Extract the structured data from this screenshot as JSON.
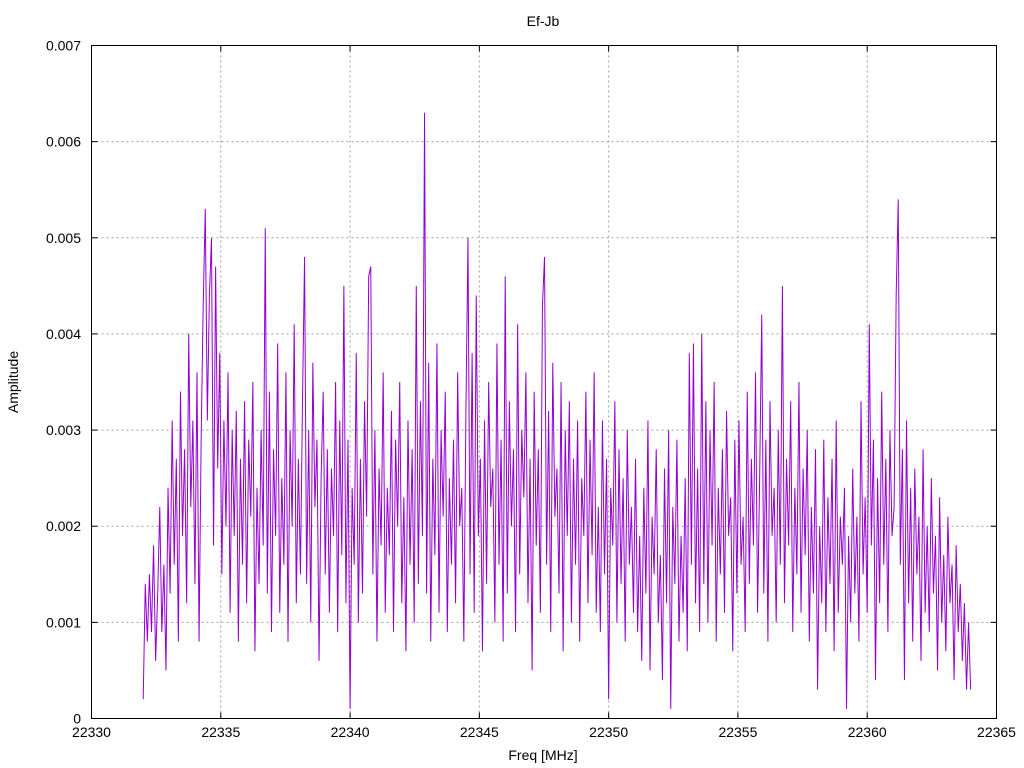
{
  "chart_data": {
    "type": "line",
    "title": "Ef-Jb",
    "xlabel": "Freq [MHz]",
    "ylabel": "Amplitude",
    "xlim": [
      22330,
      22365
    ],
    "ylim": [
      0,
      0.007
    ],
    "xticks": [
      22330,
      22335,
      22340,
      22345,
      22350,
      22355,
      22360,
      22365
    ],
    "xtick_labels": [
      "22330",
      "22335",
      "22340",
      "22345",
      "22350",
      "22355",
      "22360",
      "22365"
    ],
    "yticks": [
      0,
      0.001,
      0.002,
      0.003,
      0.004,
      0.005,
      0.006,
      0.007
    ],
    "ytick_labels": [
      "0",
      "0.001",
      "0.002",
      "0.003",
      "0.004",
      "0.005",
      "0.006",
      "0.007"
    ],
    "grid": true,
    "legend": "none",
    "series": [
      {
        "name": "Ef-Jb",
        "color": "#9400d3",
        "x_start": 22332.0,
        "x_step": 0.08,
        "values": [
          0.0002,
          0.0014,
          0.0008,
          0.0015,
          0.0009,
          0.0018,
          0.0006,
          0.0013,
          0.0022,
          0.0009,
          0.0016,
          0.0005,
          0.0024,
          0.0013,
          0.0031,
          0.0016,
          0.0027,
          0.0008,
          0.0034,
          0.0019,
          0.0028,
          0.0012,
          0.004,
          0.0022,
          0.0031,
          0.0014,
          0.0036,
          0.0008,
          0.0029,
          0.0043,
          0.0053,
          0.0031,
          0.0044,
          0.005,
          0.0018,
          0.0047,
          0.0026,
          0.0038,
          0.0015,
          0.0031,
          0.002,
          0.0036,
          0.0011,
          0.003,
          0.0019,
          0.0032,
          0.0008,
          0.0027,
          0.0016,
          0.0033,
          0.0012,
          0.0029,
          0.0021,
          0.0035,
          0.0007,
          0.0024,
          0.0014,
          0.003,
          0.0018,
          0.0051,
          0.0013,
          0.0034,
          0.0009,
          0.0028,
          0.0019,
          0.0039,
          0.0011,
          0.0025,
          0.0016,
          0.0036,
          0.0008,
          0.003,
          0.002,
          0.0041,
          0.0012,
          0.0027,
          0.0015,
          0.0033,
          0.0048,
          0.0014,
          0.003,
          0.001,
          0.0037,
          0.0022,
          0.0029,
          0.0006,
          0.0025,
          0.0034,
          0.0015,
          0.0028,
          0.0011,
          0.0026,
          0.0019,
          0.0035,
          0.0009,
          0.0031,
          0.0017,
          0.0045,
          0.0012,
          0.0029,
          0.0001,
          0.0024,
          0.0016,
          0.0038,
          0.001,
          0.0027,
          0.0013,
          0.0033,
          0.0021,
          0.0046,
          0.0047,
          0.0015,
          0.003,
          0.0008,
          0.0026,
          0.0018,
          0.0036,
          0.0011,
          0.0024,
          0.0017,
          0.0032,
          0.0009,
          0.0029,
          0.002,
          0.0035,
          0.0012,
          0.0023,
          0.0007,
          0.0031,
          0.0016,
          0.0028,
          0.001,
          0.0045,
          0.0014,
          0.0033,
          0.0019,
          0.0063,
          0.0013,
          0.0037,
          0.0008,
          0.0027,
          0.0017,
          0.0039,
          0.0011,
          0.003,
          0.0021,
          0.0034,
          0.0009,
          0.0025,
          0.0016,
          0.0029,
          0.0012,
          0.0036,
          0.002,
          0.0024,
          0.0008,
          0.0032,
          0.005,
          0.0015,
          0.0038,
          0.0011,
          0.0044,
          0.0019,
          0.0027,
          0.0007,
          0.0031,
          0.0014,
          0.0035,
          0.0022,
          0.0026,
          0.001,
          0.0039,
          0.0016,
          0.0029,
          0.0008,
          0.0046,
          0.0013,
          0.0033,
          0.002,
          0.0028,
          0.0009,
          0.0041,
          0.0015,
          0.003,
          0.0023,
          0.0036,
          0.0012,
          0.0027,
          0.0005,
          0.0034,
          0.0018,
          0.0028,
          0.0011,
          0.0043,
          0.0048,
          0.0016,
          0.0032,
          0.0009,
          0.0037,
          0.0021,
          0.0026,
          0.0013,
          0.0035,
          0.0007,
          0.003,
          0.0019,
          0.0033,
          0.001,
          0.0027,
          0.0016,
          0.0031,
          0.0008,
          0.0025,
          0.0019,
          0.0034,
          0.0012,
          0.0029,
          0.0017,
          0.0036,
          0.0011,
          0.0022,
          0.0009,
          0.0031,
          0.0015,
          0.0027,
          0.0002,
          0.0024,
          0.0018,
          0.0033,
          0.001,
          0.0028,
          0.0014,
          0.0025,
          0.0008,
          0.003,
          0.0016,
          0.0022,
          0.0011,
          0.0027,
          0.0009,
          0.0019,
          0.0006,
          0.0024,
          0.0013,
          0.0031,
          0.0005,
          0.0021,
          0.0015,
          0.0028,
          0.001,
          0.0017,
          0.0004,
          0.0026,
          0.0012,
          0.003,
          0.0001,
          0.0022,
          0.0014,
          0.0029,
          0.0008,
          0.0019,
          0.0011,
          0.0025,
          0.0007,
          0.0038,
          0.0016,
          0.0039,
          0.0012,
          0.0026,
          0.0009,
          0.004,
          0.0014,
          0.0033,
          0.001,
          0.003,
          0.0018,
          0.0035,
          0.0008,
          0.0024,
          0.0015,
          0.0028,
          0.0011,
          0.0032,
          0.0019,
          0.0023,
          0.0007,
          0.0029,
          0.0013,
          0.0031,
          0.0016,
          0.0021,
          0.0009,
          0.0034,
          0.0014,
          0.0027,
          0.0018,
          0.0036,
          0.0011,
          0.0025,
          0.0042,
          0.0013,
          0.0029,
          0.0008,
          0.0033,
          0.0019,
          0.0024,
          0.001,
          0.003,
          0.0016,
          0.0045,
          0.0012,
          0.0027,
          0.0018,
          0.0033,
          0.0009,
          0.0024,
          0.0015,
          0.0035,
          0.0011,
          0.0026,
          0.0017,
          0.003,
          0.0008,
          0.0022,
          0.0013,
          0.0028,
          0.0003,
          0.002,
          0.0012,
          0.0029,
          0.0009,
          0.0023,
          0.0014,
          0.0027,
          0.0007,
          0.0031,
          0.0011,
          0.0021,
          0.0016,
          0.0024,
          0.0001,
          0.0019,
          0.001,
          0.0026,
          0.0013,
          0.0021,
          0.0008,
          0.0033,
          0.0015,
          0.0023,
          0.0011,
          0.0041,
          0.0018,
          0.0029,
          0.0004,
          0.0025,
          0.0012,
          0.0034,
          0.0016,
          0.0027,
          0.0009,
          0.003,
          0.0019,
          0.0022,
          0.0044,
          0.0054,
          0.0016,
          0.0028,
          0.0004,
          0.0031,
          0.0012,
          0.0024,
          0.0008,
          0.0026,
          0.0015,
          0.0021,
          0.0006,
          0.0028,
          0.0011,
          0.002,
          0.0009,
          0.0025,
          0.0013,
          0.0019,
          0.0005,
          0.0023,
          0.001,
          0.0017,
          0.0007,
          0.0021,
          0.0012,
          0.0016,
          0.0004,
          0.0018,
          0.0009,
          0.0014,
          0.0006,
          0.0012,
          0.0003,
          0.001,
          0.0003
        ]
      }
    ]
  }
}
